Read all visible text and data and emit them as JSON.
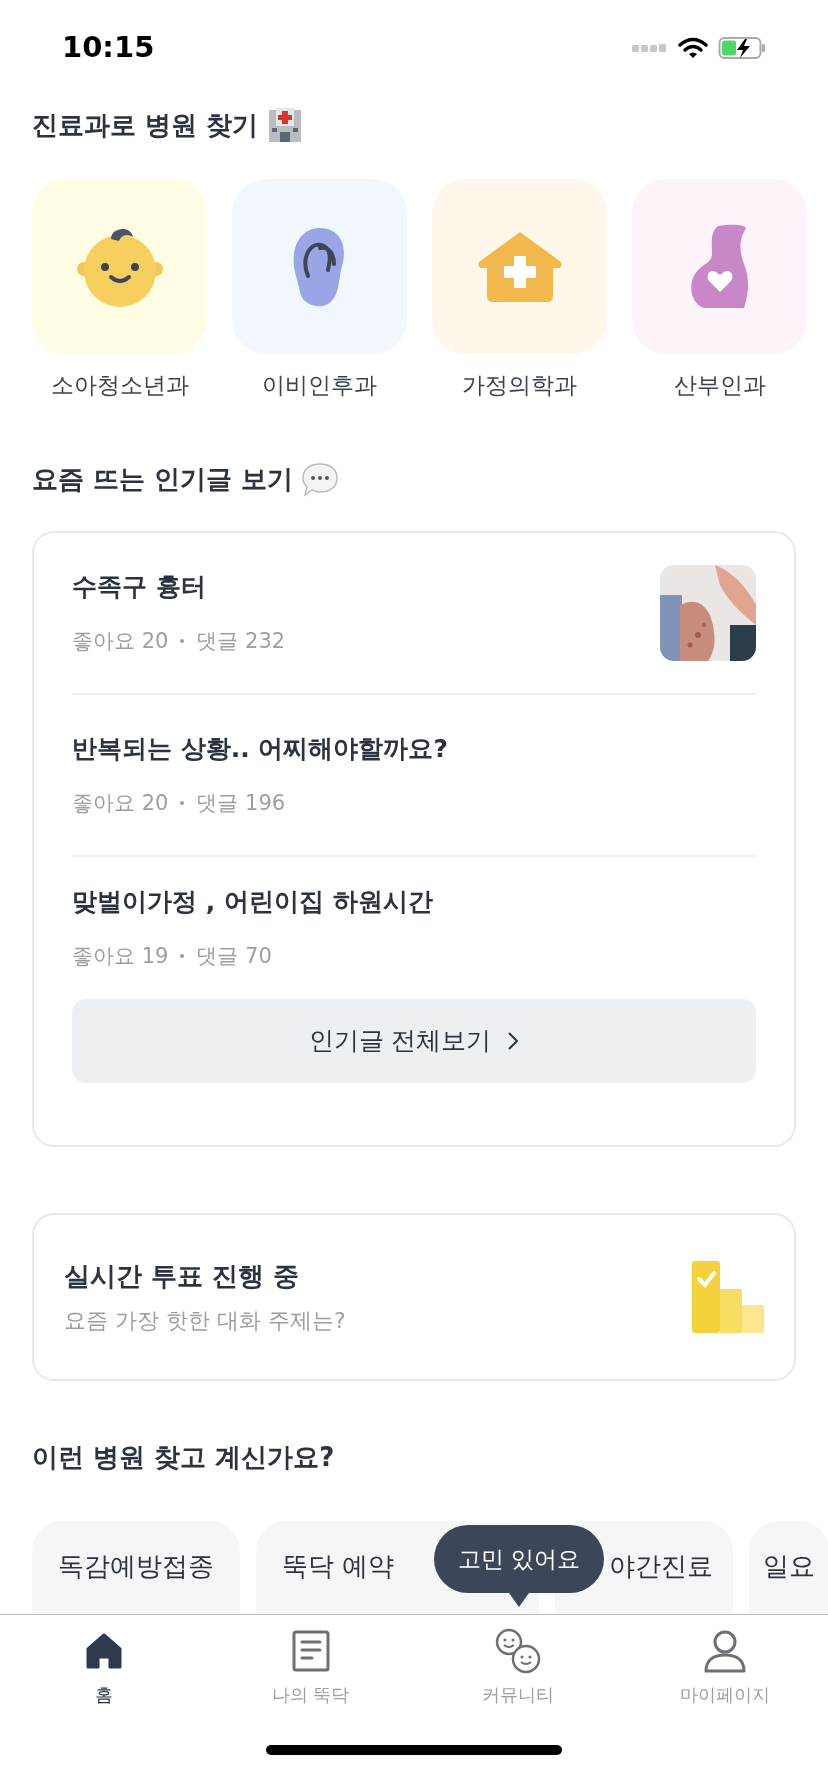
{
  "status_bar": {
    "time": "10:15"
  },
  "departments": {
    "title": "진료과로 병원 찾기",
    "items": [
      {
        "label": "소아청소년과",
        "kind": "baby"
      },
      {
        "label": "이비인후과",
        "kind": "ear"
      },
      {
        "label": "가정의학과",
        "kind": "house"
      },
      {
        "label": "산부인과",
        "kind": "pregnant"
      }
    ]
  },
  "popular": {
    "title": "요즘 뜨는 인기글 보기",
    "posts": [
      {
        "title": "수족구 흉터",
        "likes": "좋아요 20",
        "comments": "댓글 232",
        "thumbnail": true
      },
      {
        "title": "반복되는 상황.. 어찌해야할까요?",
        "likes": "좋아요 20",
        "comments": "댓글 196",
        "thumbnail": false
      },
      {
        "title": "맞벌이가정 , 어린이집 하원시간",
        "likes": "좋아요 19",
        "comments": "댓글 70",
        "thumbnail": false
      }
    ],
    "more_button": "인기글 전체보기"
  },
  "vote": {
    "title": "실시간 투표 진행 중",
    "subtitle": "요즘 가장 핫한 대화 주제는?"
  },
  "suggestions": {
    "title": "이런 병원 찾고 계신가요?",
    "chips": [
      "독감예방접종",
      "뚝닥 예약",
      "야간진료",
      "일요"
    ]
  },
  "tooltip": "고민 있어요",
  "tab_bar": [
    {
      "label": "홈",
      "kind": "home",
      "selected": true
    },
    {
      "label": "나의 뚝닥",
      "kind": "note",
      "selected": false
    },
    {
      "label": "커뮤니티",
      "kind": "community",
      "selected": false
    },
    {
      "label": "마이페이지",
      "kind": "person",
      "selected": false
    }
  ]
}
